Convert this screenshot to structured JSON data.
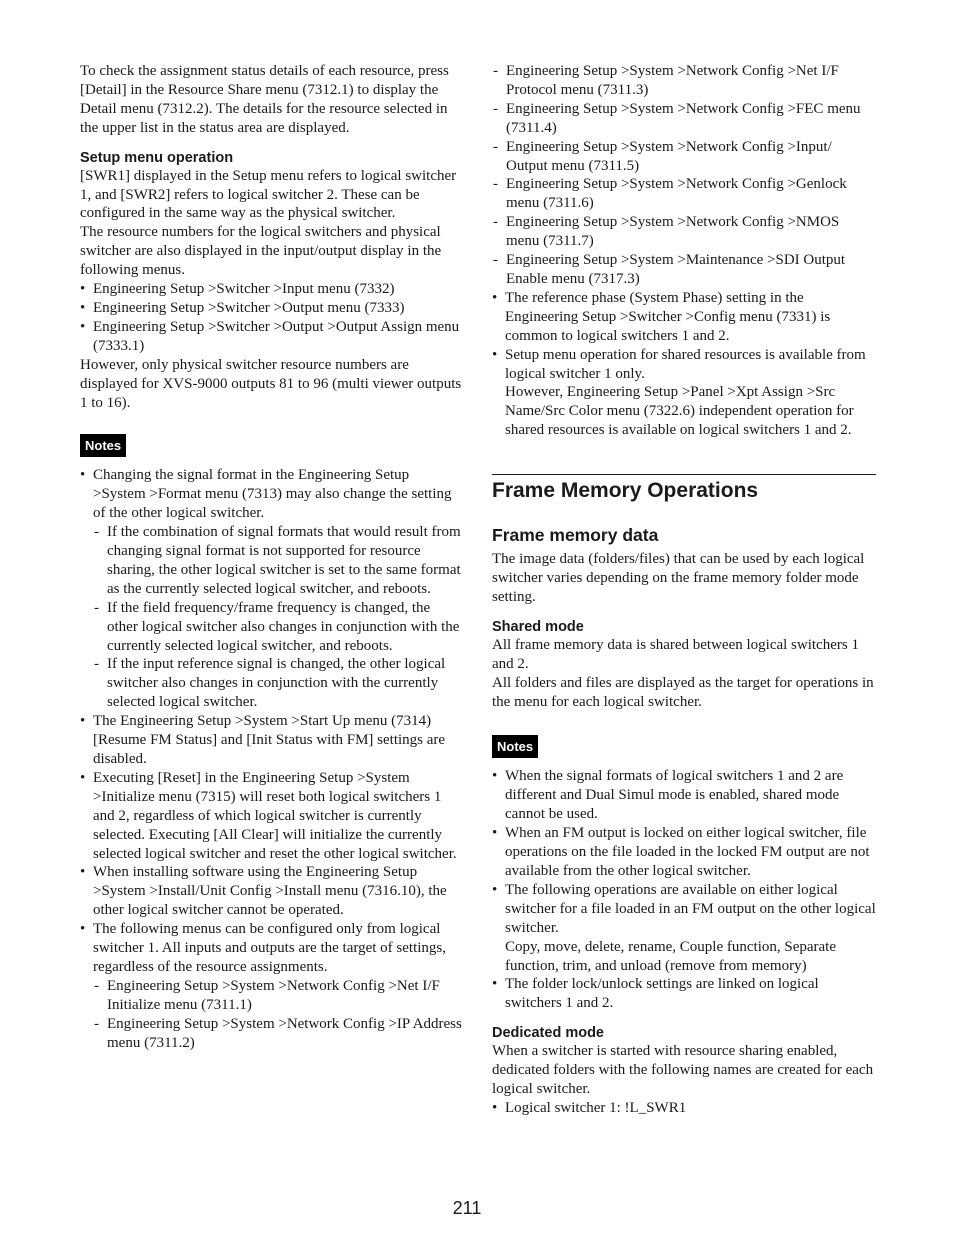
{
  "left_column": {
    "intro_paragraph": "To check the assignment status details of each resource, press [Detail] in the Resource Share menu (7312.1) to display the Detail menu (7312.2). The details for the resource selected in the upper list in the status area are displayed.",
    "setup_menu_heading": "Setup menu operation",
    "setup_para_1": "[SWR1] displayed in the Setup menu refers to logical switcher 1, and [SWR2] refers to logical switcher 2. These can be configured in the same way as the physical switcher.",
    "setup_para_2": "The resource numbers for the logical switchers and physical switcher are also displayed in the input/output display in the following menus.",
    "setup_menu_list": [
      "Engineering Setup >Switcher >Input menu (7332)",
      "Engineering Setup >Switcher >Output menu (7333)",
      "Engineering Setup >Switcher >Output >Output Assign menu (7333.1)"
    ],
    "setup_para_3": "However, only physical switcher resource numbers are displayed for XVS-9000 outputs 81 to 96 (multi viewer outputs 1 to 16).",
    "notes_label": "Notes",
    "notes": [
      {
        "text": "Changing the signal format in the Engineering Setup >System >Format menu (7313) may also change the setting of the other logical switcher.",
        "sub": [
          "If the combination of signal formats that would result from changing signal format is not supported for resource sharing, the other logical switcher is set to the same format as the currently selected logical switcher, and reboots.",
          "If the field frequency/frame frequency is changed, the other logical switcher also changes in conjunction with the currently selected logical switcher, and reboots.",
          "If the input reference signal is changed, the other logical switcher also changes in conjunction with the currently selected logical switcher."
        ]
      },
      {
        "text": "The Engineering Setup >System >Start Up menu (7314) [Resume FM Status] and [Init Status with FM] settings are disabled."
      },
      {
        "text": "Executing [Reset] in the Engineering Setup >System >Initialize menu (7315) will reset both logical switchers 1 and 2, regardless of which logical switcher is currently selected. Executing [All Clear] will initialize the currently selected logical switcher and reset the other logical switcher."
      },
      {
        "text": "When installing software using the Engineering Setup >System >Install/Unit Config >Install menu (7316.10), the other logical switcher cannot be operated."
      },
      {
        "text": "The following menus can be configured only from logical switcher 1. All inputs and outputs are the target of settings, regardless of the resource assignments.",
        "sub": [
          "Engineering Setup >System >Network Config >Net I/F Initialize menu (7311.1)",
          "Engineering Setup >System >Network Config >IP Address menu (7311.2)"
        ]
      }
    ]
  },
  "right_column": {
    "continued_sub": [
      "Engineering Setup >System >Network Config >Net I/F Protocol menu (7311.3)",
      "Engineering Setup >System >Network Config >FEC menu (7311.4)",
      "Engineering Setup >System >Network Config >Input/ Output menu (7311.5)",
      "Engineering Setup >System >Network Config >Genlock menu (7311.6)",
      "Engineering Setup >System >Network Config >NMOS menu (7311.7)",
      "Engineering Setup >System >Maintenance >SDI Output Enable menu (7317.3)"
    ],
    "continued_notes": [
      {
        "text": "The reference phase (System Phase) setting in the Engineering Setup >Switcher >Config menu (7331) is common to logical switchers 1 and 2."
      },
      {
        "text": "Setup menu operation for shared resources is available from logical switcher 1 only.",
        "extra": "However, Engineering Setup >Panel >Xpt Assign >Src Name/Src Color menu (7322.6) independent operation for shared resources is available on logical switchers 1 and 2."
      }
    ],
    "section_title": "Frame Memory Operations",
    "fm_data_heading": "Frame memory data",
    "fm_data_para": "The image data (folders/files) that can be used by each logical switcher varies depending on the frame memory folder mode setting.",
    "shared_heading": "Shared mode",
    "shared_para_1": "All frame memory data is shared between logical switchers 1 and 2.",
    "shared_para_2": "All folders and files are displayed as the target for operations in the menu for each logical switcher.",
    "notes_label": "Notes",
    "shared_notes": [
      {
        "text": "When the signal formats of logical switchers 1 and 2 are different and Dual Simul mode is enabled, shared mode cannot be used."
      },
      {
        "text": "When an FM output is locked on either logical switcher, file operations on the file loaded in the locked FM output are not available from the other logical switcher."
      },
      {
        "text": "The following operations are available on either logical switcher for a file loaded in an FM output on the other logical switcher.",
        "extra": "Copy, move, delete, rename, Couple function, Separate function, trim, and unload (remove from memory)"
      },
      {
        "text": "The folder lock/unlock settings are linked on logical switchers 1 and 2."
      }
    ],
    "dedicated_heading": "Dedicated mode",
    "dedicated_para": "When a switcher is started with resource sharing enabled, dedicated folders with the following names are created for each logical switcher.",
    "dedicated_list": [
      "Logical switcher 1: !L_SWR1"
    ]
  },
  "page_number": "211"
}
